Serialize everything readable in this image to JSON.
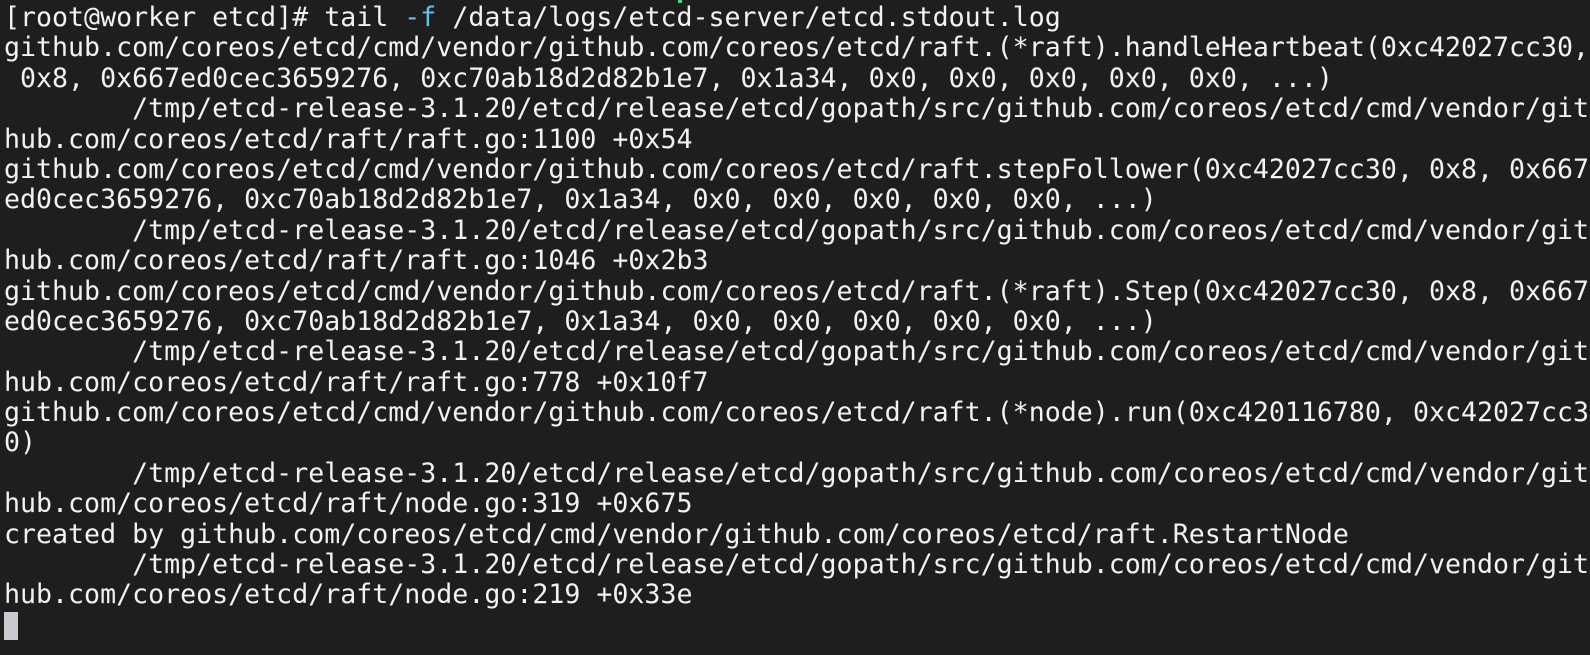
{
  "terminal": {
    "prompt": "[root@worker etcd]# ",
    "command_pre": "tail ",
    "command_flag": "-f",
    "command_post": " /data/logs/etcd-server/etcd.stdout.log",
    "lines": [
      "github.com/coreos/etcd/cmd/vendor/github.com/coreos/etcd/raft.(*raft).handleHeartbeat(0xc42027cc30,",
      " 0x8, 0x667ed0cec3659276, 0xc70ab18d2d82b1e7, 0x1a34, 0x0, 0x0, 0x0, 0x0, 0x0, ...)",
      "        /tmp/etcd-release-3.1.20/etcd/release/etcd/gopath/src/github.com/coreos/etcd/cmd/vendor/git",
      "hub.com/coreos/etcd/raft/raft.go:1100 +0x54",
      "github.com/coreos/etcd/cmd/vendor/github.com/coreos/etcd/raft.stepFollower(0xc42027cc30, 0x8, 0x667",
      "ed0cec3659276, 0xc70ab18d2d82b1e7, 0x1a34, 0x0, 0x0, 0x0, 0x0, 0x0, ...)",
      "        /tmp/etcd-release-3.1.20/etcd/release/etcd/gopath/src/github.com/coreos/etcd/cmd/vendor/git",
      "hub.com/coreos/etcd/raft/raft.go:1046 +0x2b3",
      "github.com/coreos/etcd/cmd/vendor/github.com/coreos/etcd/raft.(*raft).Step(0xc42027cc30, 0x8, 0x667",
      "ed0cec3659276, 0xc70ab18d2d82b1e7, 0x1a34, 0x0, 0x0, 0x0, 0x0, 0x0, ...)",
      "        /tmp/etcd-release-3.1.20/etcd/release/etcd/gopath/src/github.com/coreos/etcd/cmd/vendor/git",
      "hub.com/coreos/etcd/raft/raft.go:778 +0x10f7",
      "github.com/coreos/etcd/cmd/vendor/github.com/coreos/etcd/raft.(*node).run(0xc420116780, 0xc42027cc3",
      "0)",
      "        /tmp/etcd-release-3.1.20/etcd/release/etcd/gopath/src/github.com/coreos/etcd/cmd/vendor/git",
      "hub.com/coreos/etcd/raft/node.go:319 +0x675",
      "created by github.com/coreos/etcd/cmd/vendor/github.com/coreos/etcd/raft.RestartNode",
      "        /tmp/etcd-release-3.1.20/etcd/release/etcd/gopath/src/github.com/coreos/etcd/cmd/vendor/git",
      "hub.com/coreos/etcd/raft/node.go:219 +0x33e"
    ]
  },
  "colors": {
    "background": "#1e1e1e",
    "text": "#f2f2f2",
    "flag": "#59c7f0",
    "cursor": "#c9c9d1"
  }
}
